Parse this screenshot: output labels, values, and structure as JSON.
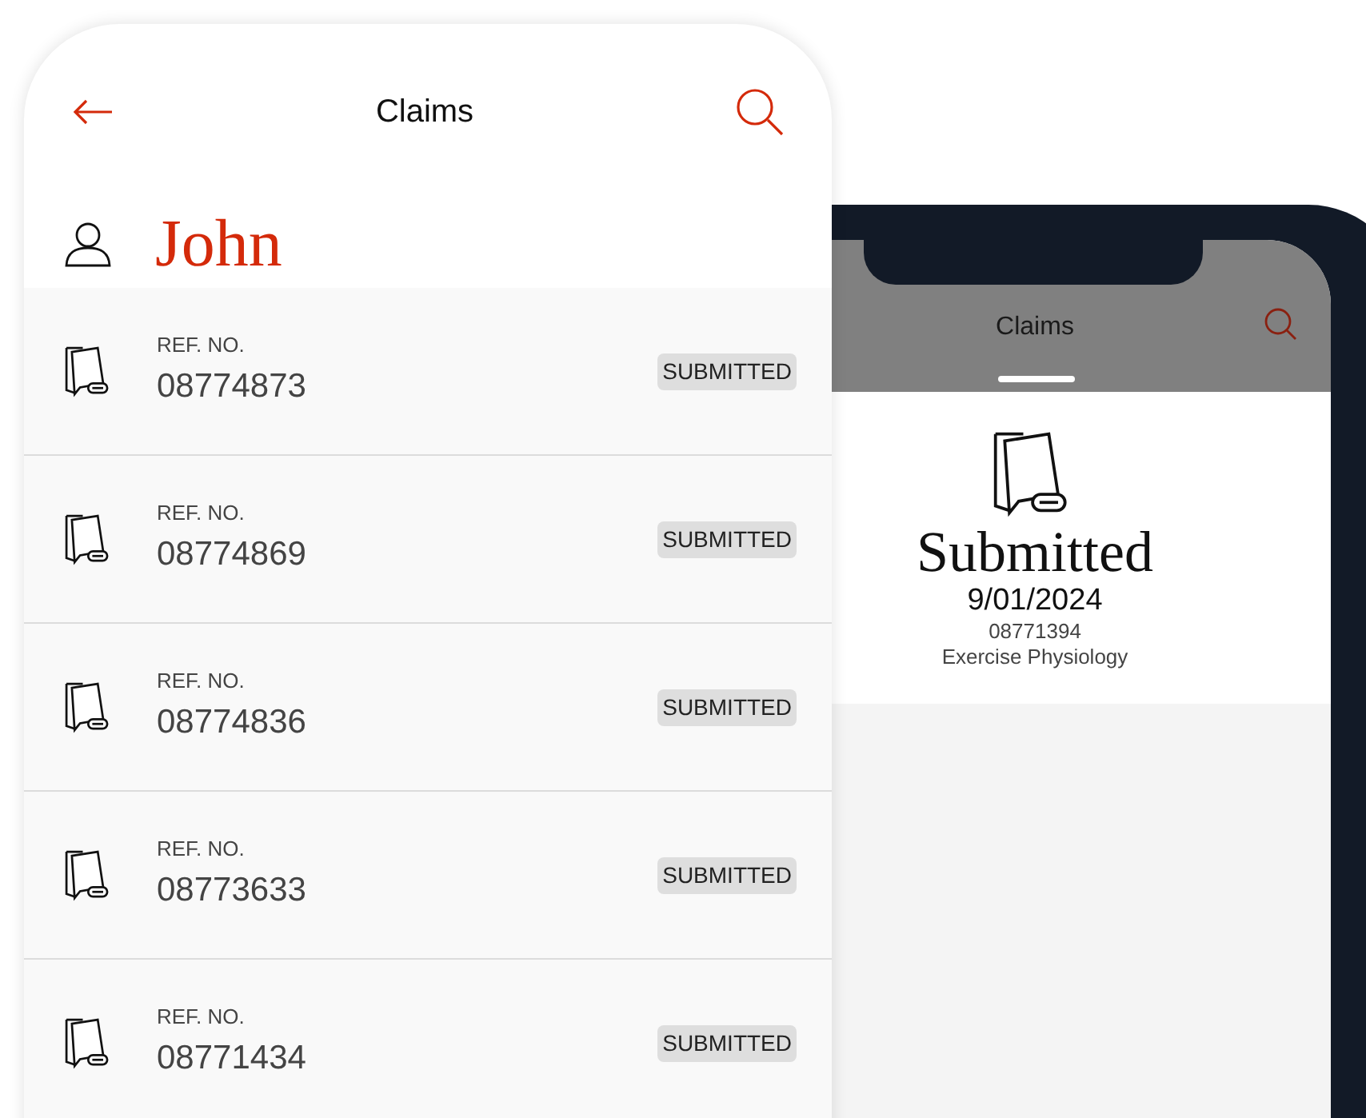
{
  "front_screen": {
    "title": "Claims",
    "user_name": "John",
    "claims": [
      {
        "label": "REF. NO.",
        "ref": "08774873",
        "status": "SUBMITTED"
      },
      {
        "label": "REF. NO.",
        "ref": "08774869",
        "status": "SUBMITTED"
      },
      {
        "label": "REF. NO.",
        "ref": "08774836",
        "status": "SUBMITTED"
      },
      {
        "label": "REF. NO.",
        "ref": "08773633",
        "status": "SUBMITTED"
      },
      {
        "label": "REF. NO.",
        "ref": "08771434",
        "status": "SUBMITTED"
      }
    ]
  },
  "back_screen": {
    "title": "Claims",
    "detail": {
      "status": "Submitted",
      "date": "9/01/2024",
      "ref": "08771394",
      "type": "Exercise Physiology"
    }
  }
}
